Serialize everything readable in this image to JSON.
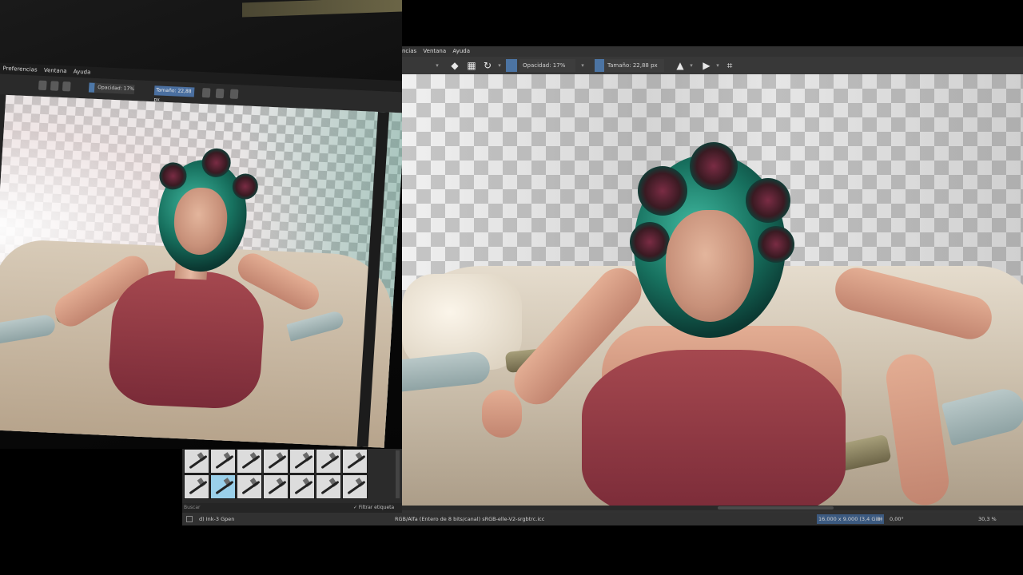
{
  "photo_monitor": {
    "menu": [
      "Preferencias",
      "Ventana",
      "Ayuda"
    ],
    "toolbar": {
      "opacity_label": "Opacidad: 17%",
      "size_label": "Tamaño: 22,88 px"
    }
  },
  "app": {
    "menu": [
      "ncias",
      "Ventana",
      "Ayuda"
    ],
    "toolbar": {
      "eraser_icon": "eraser-icon",
      "opacity_label": "Opacidad: 17%",
      "size_label": "Tamaño: 22,88 px",
      "color_swatch": "#4c74a3"
    }
  },
  "brush_presets": {
    "selected_index": 8,
    "search_placeholder": "Buscar",
    "filter_label": "✓ Filtrar etiqueta"
  },
  "status": {
    "brush_name": "d) Ink-3 Gpen",
    "color_space": "RGB/Alfa (Entero de 8 bits/canal)  sRGB-elle-V2-srgbtrc.icc",
    "dimensions": "16.000 x 9.000 (3,4 GiB)",
    "rotation": "0,00°",
    "zoom": "30,3 %"
  }
}
